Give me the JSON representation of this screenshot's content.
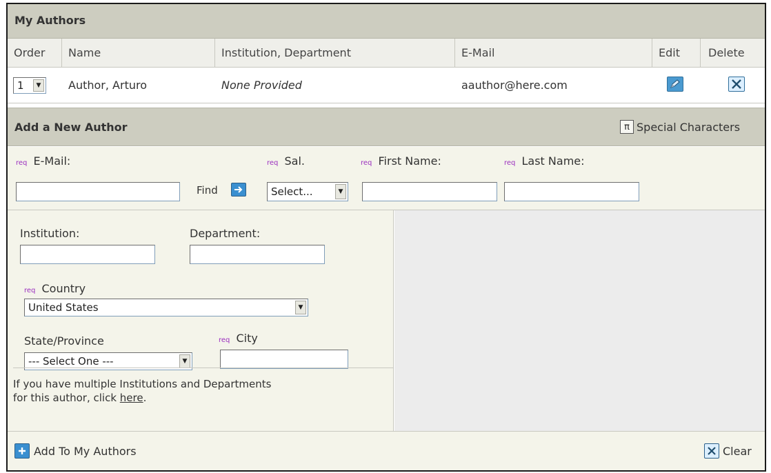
{
  "my_authors": {
    "title": "My Authors",
    "columns": [
      "Order",
      "Name",
      "Institution, Department",
      "E-Mail",
      "Edit",
      "Delete"
    ],
    "rows": [
      {
        "order": "1",
        "name": "Author, Arturo",
        "institution": "None Provided",
        "email": "aauthor@here.com"
      }
    ]
  },
  "add_author": {
    "title": "Add a New Author",
    "special_characters_label": "Special Characters",
    "special_characters_glyph": "π",
    "req_label": "req",
    "email_label": "E-Mail:",
    "find_label": "Find",
    "sal_label": "Sal.",
    "sal_value": "Select...",
    "first_name_label": "First Name:",
    "last_name_label": "Last Name:",
    "institution_label": "Institution:",
    "department_label": "Department:",
    "country_label": "Country",
    "country_value": "United States",
    "state_label": "State/Province",
    "state_value": "--- Select One ---",
    "city_label": "City",
    "multi_text": "If you have multiple Institutions and Departments",
    "multi_text2_prefix": "for this author, click ",
    "multi_link": "here",
    "multi_text2_suffix": ".",
    "add_button": "Add To My Authors",
    "clear_button": "Clear"
  },
  "colors": {
    "header_bar": "#cdcdc0",
    "form_bg": "#f4f4ea",
    "req": "#9b2fbf",
    "icon_blue": "#3a8fd0"
  }
}
